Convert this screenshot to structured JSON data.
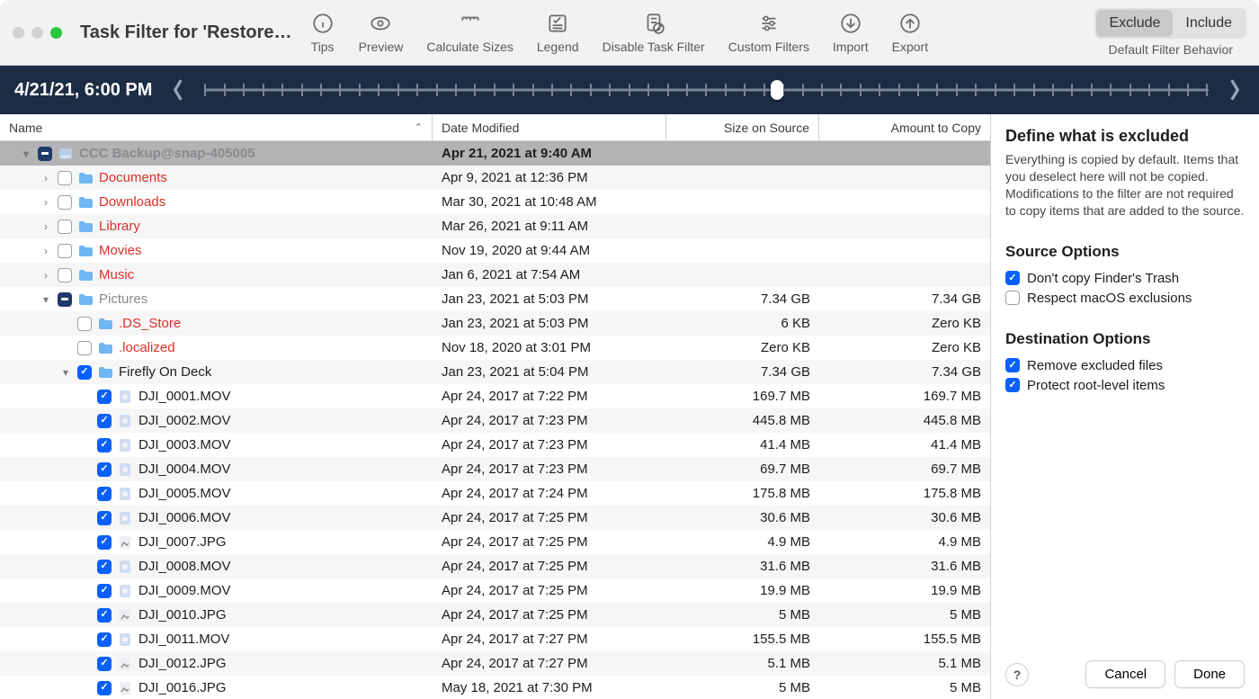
{
  "window": {
    "title": "Task Filter for 'Restore…"
  },
  "toolbar": {
    "items": [
      {
        "id": "tips",
        "label": "Tips"
      },
      {
        "id": "preview",
        "label": "Preview"
      },
      {
        "id": "calc",
        "label": "Calculate Sizes"
      },
      {
        "id": "legend",
        "label": "Legend"
      },
      {
        "id": "disable",
        "label": "Disable Task Filter"
      },
      {
        "id": "custom",
        "label": "Custom Filters"
      },
      {
        "id": "import",
        "label": "Import"
      },
      {
        "id": "export",
        "label": "Export"
      }
    ],
    "filter_behavior": {
      "label": "Default Filter Behavior",
      "options": [
        "Exclude",
        "Include"
      ],
      "active": "Exclude"
    }
  },
  "timeline": {
    "timestamp": "4/21/21, 6:00 PM",
    "position_pct": 57,
    "tick_count": 53
  },
  "columns": {
    "name": "Name",
    "date": "Date Modified",
    "size": "Size on Source",
    "amount": "Amount to Copy",
    "sort_col": "name",
    "sort_dir": "asc"
  },
  "tree": [
    {
      "depth": 0,
      "expand": "open",
      "check": "mixed",
      "icon": "disk",
      "name": "CCC Backup@snap-405005",
      "date": "Apr 21, 2021 at 9:40 AM",
      "size": "",
      "amount": "",
      "selected": true,
      "color": "muted"
    },
    {
      "depth": 1,
      "expand": "closed",
      "check": "empty",
      "icon": "folder",
      "name": "Documents",
      "date": "Apr 9, 2021 at 12:36 PM",
      "size": "",
      "amount": "",
      "color": "red"
    },
    {
      "depth": 1,
      "expand": "closed",
      "check": "empty",
      "icon": "folder",
      "name": "Downloads",
      "date": "Mar 30, 2021 at 10:48 AM",
      "size": "",
      "amount": "",
      "color": "red"
    },
    {
      "depth": 1,
      "expand": "closed",
      "check": "empty",
      "icon": "folder",
      "name": "Library",
      "date": "Mar 26, 2021 at 9:11 AM",
      "size": "",
      "amount": "",
      "color": "red"
    },
    {
      "depth": 1,
      "expand": "closed",
      "check": "empty",
      "icon": "folder",
      "name": "Movies",
      "date": "Nov 19, 2020 at 9:44 AM",
      "size": "",
      "amount": "",
      "color": "red"
    },
    {
      "depth": 1,
      "expand": "closed",
      "check": "empty",
      "icon": "folder",
      "name": "Music",
      "date": "Jan 6, 2021 at 7:54 AM",
      "size": "",
      "amount": "",
      "color": "red"
    },
    {
      "depth": 1,
      "expand": "open",
      "check": "mixed",
      "icon": "folder",
      "name": "Pictures",
      "date": "Jan 23, 2021 at 5:03 PM",
      "size": "7.34 GB",
      "amount": "7.34 GB",
      "color": "muted"
    },
    {
      "depth": 2,
      "expand": "none",
      "check": "empty",
      "icon": "folder",
      "name": ".DS_Store",
      "date": "Jan 23, 2021 at 5:03 PM",
      "size": "6 KB",
      "amount": "Zero KB",
      "color": "red"
    },
    {
      "depth": 2,
      "expand": "none",
      "check": "empty",
      "icon": "folder",
      "name": ".localized",
      "date": "Nov 18, 2020 at 3:01 PM",
      "size": "Zero KB",
      "amount": "Zero KB",
      "color": "red"
    },
    {
      "depth": 2,
      "expand": "open",
      "check": "checked",
      "icon": "folder",
      "name": "Firefly On Deck",
      "date": "Jan 23, 2021 at 5:04 PM",
      "size": "7.34 GB",
      "amount": "7.34 GB"
    },
    {
      "depth": 3,
      "expand": "none",
      "check": "checked",
      "icon": "mov",
      "name": "DJI_0001.MOV",
      "date": "Apr 24, 2017 at 7:22 PM",
      "size": "169.7 MB",
      "amount": "169.7 MB"
    },
    {
      "depth": 3,
      "expand": "none",
      "check": "checked",
      "icon": "mov",
      "name": "DJI_0002.MOV",
      "date": "Apr 24, 2017 at 7:23 PM",
      "size": "445.8 MB",
      "amount": "445.8 MB"
    },
    {
      "depth": 3,
      "expand": "none",
      "check": "checked",
      "icon": "mov",
      "name": "DJI_0003.MOV",
      "date": "Apr 24, 2017 at 7:23 PM",
      "size": "41.4 MB",
      "amount": "41.4 MB"
    },
    {
      "depth": 3,
      "expand": "none",
      "check": "checked",
      "icon": "mov",
      "name": "DJI_0004.MOV",
      "date": "Apr 24, 2017 at 7:23 PM",
      "size": "69.7 MB",
      "amount": "69.7 MB"
    },
    {
      "depth": 3,
      "expand": "none",
      "check": "checked",
      "icon": "mov",
      "name": "DJI_0005.MOV",
      "date": "Apr 24, 2017 at 7:24 PM",
      "size": "175.8 MB",
      "amount": "175.8 MB"
    },
    {
      "depth": 3,
      "expand": "none",
      "check": "checked",
      "icon": "mov",
      "name": "DJI_0006.MOV",
      "date": "Apr 24, 2017 at 7:25 PM",
      "size": "30.6 MB",
      "amount": "30.6 MB"
    },
    {
      "depth": 3,
      "expand": "none",
      "check": "checked",
      "icon": "jpg",
      "name": "DJI_0007.JPG",
      "date": "Apr 24, 2017 at 7:25 PM",
      "size": "4.9 MB",
      "amount": "4.9 MB"
    },
    {
      "depth": 3,
      "expand": "none",
      "check": "checked",
      "icon": "mov",
      "name": "DJI_0008.MOV",
      "date": "Apr 24, 2017 at 7:25 PM",
      "size": "31.6 MB",
      "amount": "31.6 MB"
    },
    {
      "depth": 3,
      "expand": "none",
      "check": "checked",
      "icon": "mov",
      "name": "DJI_0009.MOV",
      "date": "Apr 24, 2017 at 7:25 PM",
      "size": "19.9 MB",
      "amount": "19.9 MB"
    },
    {
      "depth": 3,
      "expand": "none",
      "check": "checked",
      "icon": "jpg",
      "name": "DJI_0010.JPG",
      "date": "Apr 24, 2017 at 7:25 PM",
      "size": "5 MB",
      "amount": "5 MB"
    },
    {
      "depth": 3,
      "expand": "none",
      "check": "checked",
      "icon": "mov",
      "name": "DJI_0011.MOV",
      "date": "Apr 24, 2017 at 7:27 PM",
      "size": "155.5 MB",
      "amount": "155.5 MB"
    },
    {
      "depth": 3,
      "expand": "none",
      "check": "checked",
      "icon": "jpg",
      "name": "DJI_0012.JPG",
      "date": "Apr 24, 2017 at 7:27 PM",
      "size": "5.1 MB",
      "amount": "5.1 MB"
    },
    {
      "depth": 3,
      "expand": "none",
      "check": "checked",
      "icon": "jpg",
      "name": "DJI_0016.JPG",
      "date": "May 18, 2021 at 7:30 PM",
      "size": "5 MB",
      "amount": "5 MB"
    }
  ],
  "sidebar": {
    "heading": "Define what is excluded",
    "body": "Everything is copied by default. Items that you deselect here will not be copied. Modifications to the filter are not required to copy items that are added to the source.",
    "source_options": {
      "heading": "Source Options",
      "items": [
        {
          "label": "Don't copy Finder's Trash",
          "checked": true
        },
        {
          "label": "Respect macOS exclusions",
          "checked": false
        }
      ]
    },
    "dest_options": {
      "heading": "Destination Options",
      "items": [
        {
          "label": "Remove excluded files",
          "checked": true
        },
        {
          "label": "Protect root-level items",
          "checked": true
        }
      ]
    }
  },
  "footer": {
    "help": "?",
    "cancel": "Cancel",
    "done": "Done"
  }
}
